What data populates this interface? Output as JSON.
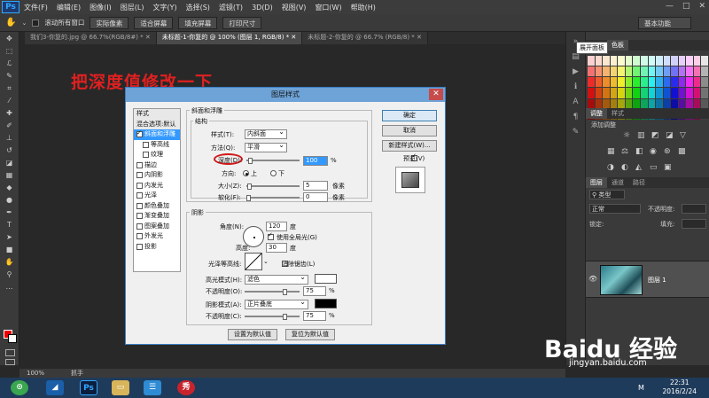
{
  "menubar": {
    "logo": "Ps",
    "items": [
      "文件(F)",
      "编辑(E)",
      "图像(I)",
      "图层(L)",
      "文字(Y)",
      "选择(S)",
      "滤镜(T)",
      "3D(D)",
      "视图(V)",
      "窗口(W)",
      "帮助(H)"
    ],
    "window_controls": [
      "—",
      "□",
      "✕"
    ]
  },
  "optbar": {
    "scroll_all_label": "滚动所有窗口",
    "buttons": [
      "实际像素",
      "适合屏幕",
      "填充屏幕",
      "打印尺寸"
    ],
    "workspace": "基本功能"
  },
  "tabs": [
    {
      "label": "我们3-你复的.jpg @ 66.7%(RGB/8#) *  ✕",
      "active": false
    },
    {
      "label": "未标题-1-你复的 @ 100% (图层 1, RGB/8) *  ✕",
      "active": true
    },
    {
      "label": "未标题-2-你复的 @ 66.7% (RGB/8) *  ✕",
      "active": false
    }
  ],
  "annotation": "把深度值修改一下",
  "dialog": {
    "title": "图层样式",
    "close": "✕",
    "style_list": [
      {
        "label": "样式",
        "kind": "head"
      },
      {
        "label": "混合选项:默认",
        "kind": "head"
      },
      {
        "label": "斜面和浮雕",
        "kind": "sel",
        "checked": true
      },
      {
        "label": "等高线",
        "kind": "sub",
        "checked": false
      },
      {
        "label": "纹理",
        "kind": "sub",
        "checked": false
      },
      {
        "label": "描边",
        "kind": "item",
        "checked": false
      },
      {
        "label": "内阴影",
        "kind": "item",
        "checked": false
      },
      {
        "label": "内发光",
        "kind": "item",
        "checked": false
      },
      {
        "label": "光泽",
        "kind": "item",
        "checked": false
      },
      {
        "label": "颜色叠加",
        "kind": "item",
        "checked": false
      },
      {
        "label": "渐变叠加",
        "kind": "item",
        "checked": false
      },
      {
        "label": "图案叠加",
        "kind": "item",
        "checked": false
      },
      {
        "label": "外发光",
        "kind": "item",
        "checked": false
      },
      {
        "label": "投影",
        "kind": "item",
        "checked": false
      }
    ],
    "bevel": {
      "group_title": "斜面和浮雕",
      "structure_title": "结构",
      "style_label": "样式(T):",
      "style_value": "内斜面",
      "technique_label": "方法(Q):",
      "technique_value": "平滑",
      "depth_label": "深度(D):",
      "depth_value": "100",
      "depth_unit": "%",
      "direction_label": "方向:",
      "dir_up": "上",
      "dir_down": "下",
      "size_label": "大小(Z):",
      "size_value": "5",
      "size_unit": "像素",
      "soften_label": "软化(F):",
      "soften_value": "0",
      "soften_unit": "像素"
    },
    "shading": {
      "title": "阴影",
      "angle_label": "角度(N):",
      "angle_value": "120",
      "angle_unit": "度",
      "global_light_label": "使用全局光(G)",
      "altitude_label": "高度:",
      "altitude_value": "30",
      "altitude_unit": "度",
      "gloss_label": "光泽等高线:",
      "antialias_label": "消除锯齿(L)",
      "highlight_label": "高光模式(H):",
      "highlight_value": "滤色",
      "hl_opacity_label": "不透明度(O):",
      "hl_opacity_value": "75",
      "shadow_label": "阴影模式(A):",
      "shadow_value": "正片叠底",
      "sh_opacity_label": "不透明度(C):",
      "sh_opacity_value": "75",
      "pct": "%",
      "highlight_color": "#ffffff",
      "shadow_color": "#000000"
    },
    "make_default": "设置为默认值",
    "reset_default": "复位为默认值",
    "ok": "确定",
    "cancel": "取消",
    "new_style": "新建样式(W)...",
    "preview_label": "预览(V)"
  },
  "tooltip": "展开面板",
  "panels": {
    "color_tabs": [
      "颜色",
      "色板"
    ],
    "adjust_tabs": [
      "调整",
      "样式"
    ],
    "adjust_hint": "添加调整",
    "layer_tabs": [
      "图层",
      "通道",
      "路径"
    ],
    "kind_label": "类型",
    "blend_mode": "正常",
    "opacity_label": "不透明度:",
    "lock_label": "锁定:",
    "fill_label": "填充:",
    "layer_name": "图层 1"
  },
  "statusbar": {
    "zoom": "100%",
    "info": "抓手"
  },
  "taskbar": {
    "time": "22:31",
    "date": "2016/2/24",
    "ime": "M"
  },
  "watermark": {
    "logo": "Baidu 经验",
    "url": "jingyan.baidu.com"
  }
}
